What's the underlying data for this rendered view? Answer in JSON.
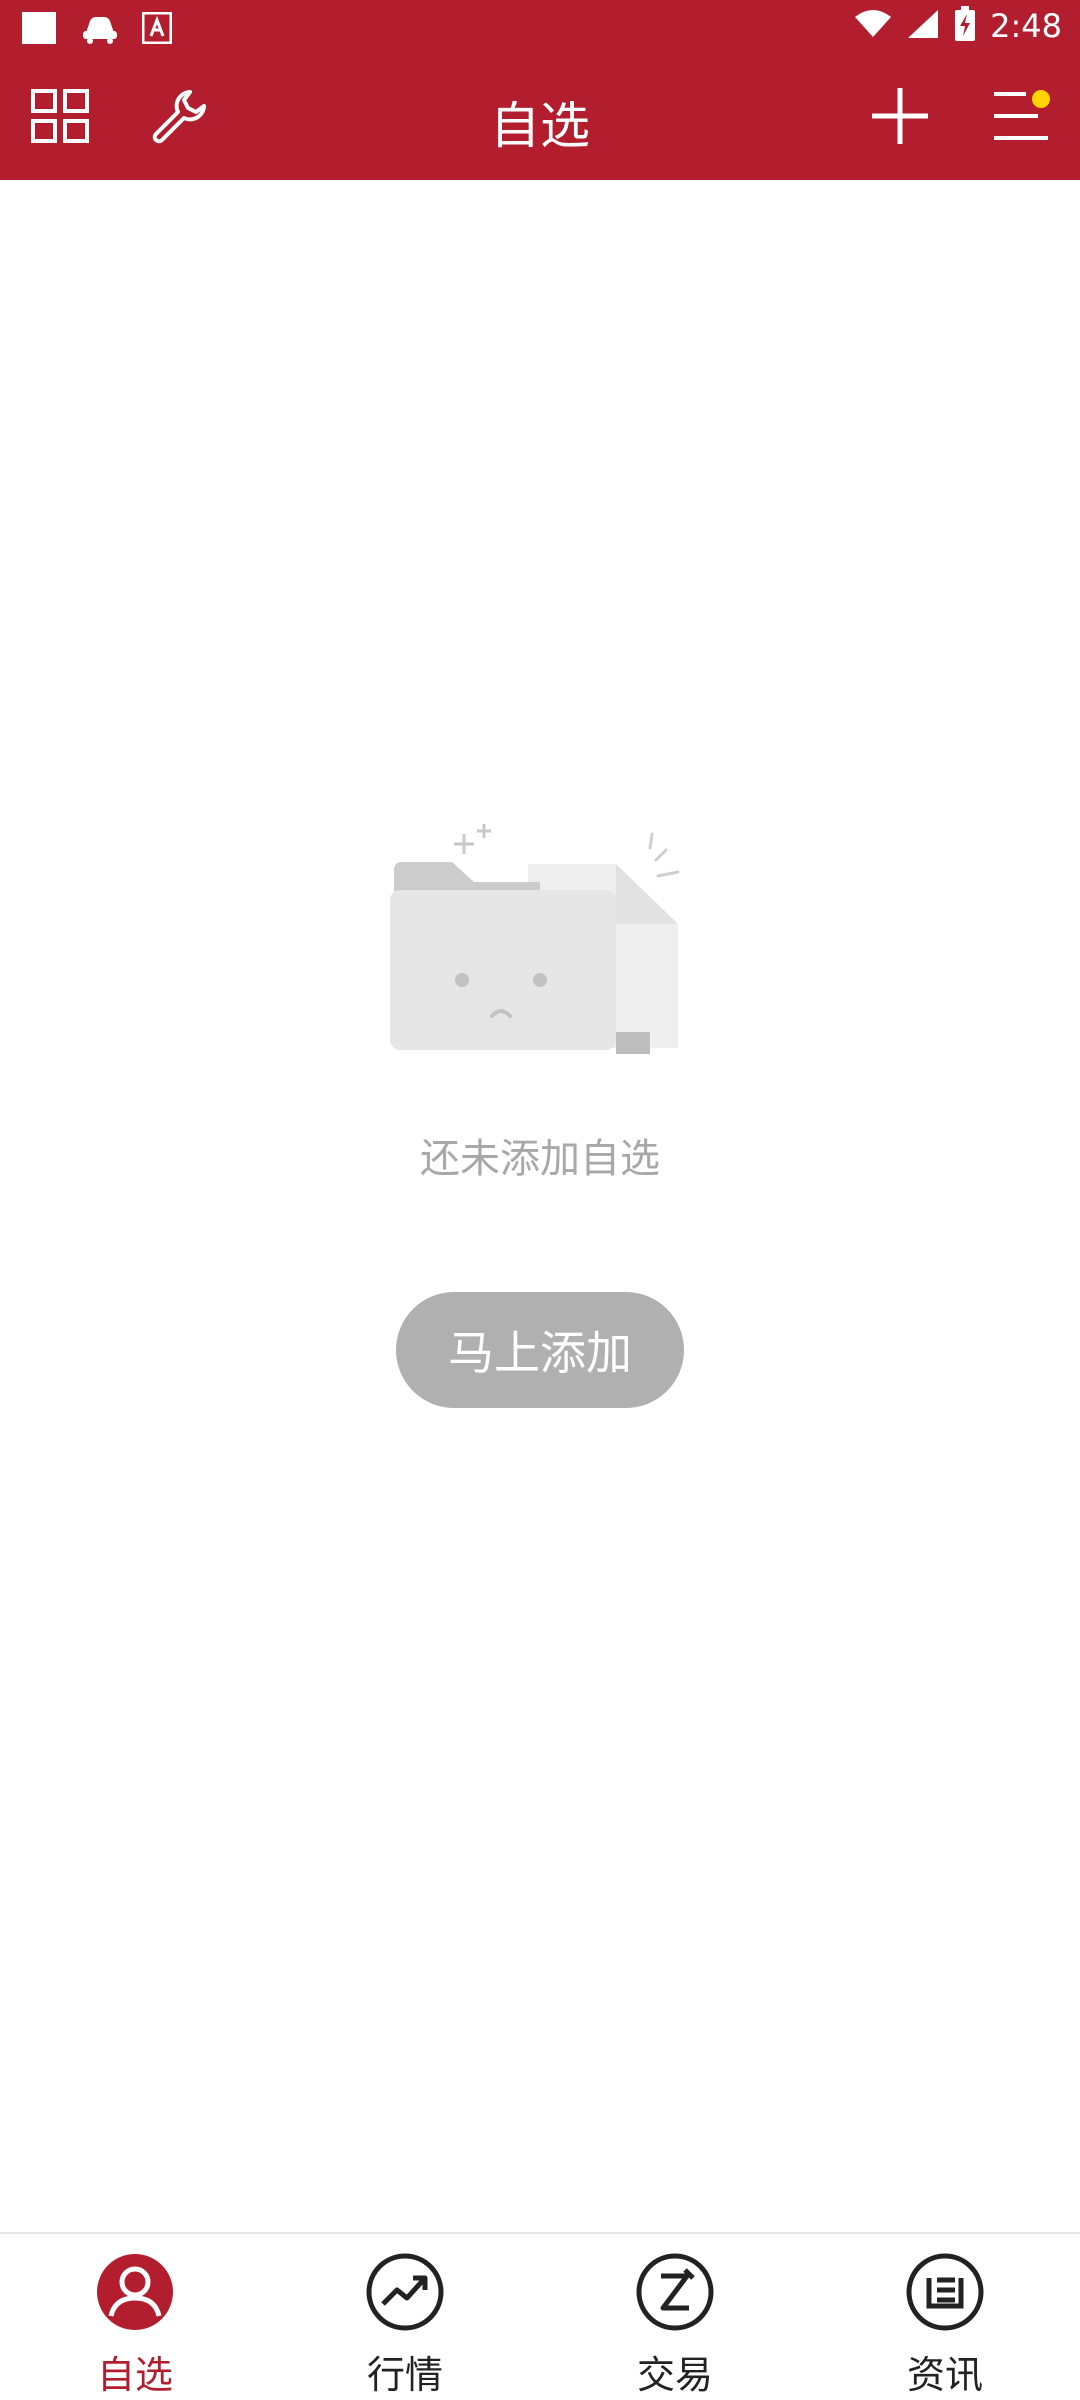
{
  "status_bar": {
    "time": "2:48",
    "icons": [
      "white-square-icon",
      "car-icon",
      "text-app-icon",
      "wifi-icon",
      "signal-icon",
      "battery-charging-icon"
    ]
  },
  "app_bar": {
    "title": "自选",
    "left_icons": [
      "grid-icon",
      "wrench-icon"
    ],
    "right_icons": [
      "plus-icon",
      "menu-icon"
    ],
    "badge_color": "#ffd400"
  },
  "empty_state": {
    "message": "还未添加自选",
    "button_label": "马上添加",
    "illustration": "empty-folder-icon"
  },
  "bottom_nav": {
    "items": [
      {
        "label": "自选",
        "icon": "person-icon",
        "active": true
      },
      {
        "label": "行情",
        "icon": "trend-chart-icon",
        "active": false
      },
      {
        "label": "交易",
        "icon": "trade-icon",
        "active": false
      },
      {
        "label": "资讯",
        "icon": "news-icon",
        "active": false
      }
    ]
  },
  "colors": {
    "brand": "#b31e2f",
    "empty_text": "#a8a8a8",
    "button_bg": "#b0b0b0"
  }
}
